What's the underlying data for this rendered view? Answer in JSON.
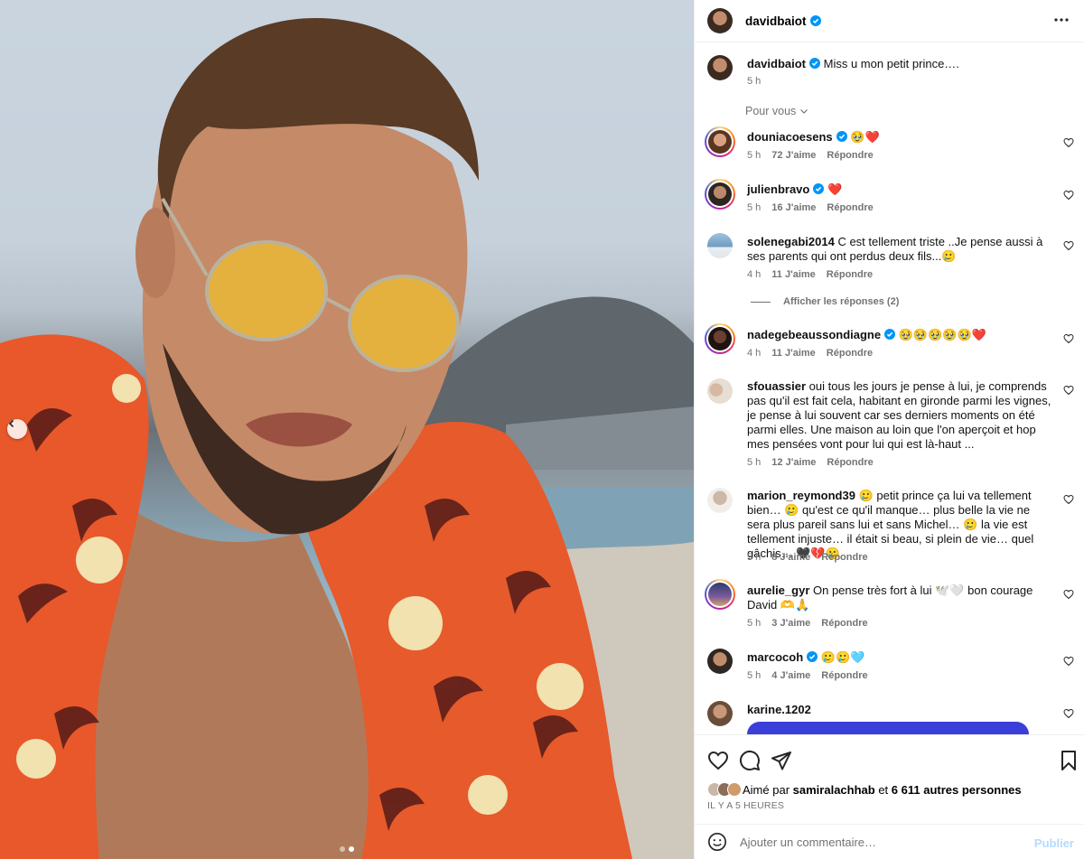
{
  "post": {
    "author": "davidbaiot",
    "caption_author": "davidbaiot",
    "caption": "Miss u mon petit prince….",
    "caption_time": "5 h"
  },
  "sort": {
    "label": "Pour vous"
  },
  "comments": [
    {
      "user": "douniacoesens",
      "verified": true,
      "text": "🥹❤️",
      "time": "5 h",
      "likes": "72 J'aime",
      "reply": "Répondre"
    },
    {
      "user": "julienbravo",
      "verified": true,
      "text": "❤️",
      "time": "5 h",
      "likes": "16 J'aime",
      "reply": "Répondre"
    },
    {
      "user": "solenegabi2014",
      "verified": false,
      "text": "C est tellement triste ..Je pense aussi à ses parents qui ont perdus deux fils...🥲",
      "time": "4 h",
      "likes": "11 J'aime",
      "reply": "Répondre"
    },
    {
      "user": "nadegebeaussondiagne",
      "verified": true,
      "text": "🥹🥹🥹🥹🥹❤️",
      "time": "4 h",
      "likes": "11 J'aime",
      "reply": "Répondre"
    },
    {
      "user": "sfouassier",
      "verified": false,
      "text": "oui tous les jours je pense à lui, je comprends pas qu'il est fait cela, habitant en gironde parmi les vignes, je pense à lui souvent car ses derniers moments on été parmi elles. Une maison au loin que l'on aperçoit et hop mes pensées vont pour lui qui est là-haut ...",
      "time": "5 h",
      "likes": "12 J'aime",
      "reply": "Répondre"
    },
    {
      "user": "marion_reymond39",
      "verified": false,
      "text": "🥲 petit prince ça lui va tellement bien… 🥲 qu'est ce qu'il manque… plus belle la vie ne sera plus pareil sans lui et sans Michel… 🥲 la vie est tellement injuste… il était si beau, si plein de vie… quel gâchis… 🖤💔🥲",
      "time": "5 h",
      "likes": "8 J'aime",
      "reply": "Répondre"
    },
    {
      "user": "aurelie_gyr",
      "verified": false,
      "text": "On pense très fort à lui 🕊️🤍 bon courage David 🫶🙏",
      "time": "5 h",
      "likes": "3 J'aime",
      "reply": "Répondre"
    },
    {
      "user": "marcocoh",
      "verified": true,
      "text": "🥲🥲🩵",
      "time": "5 h",
      "likes": "4 J'aime",
      "reply": "Répondre"
    },
    {
      "user": "karine.1202",
      "verified": false,
      "text": "",
      "time": "",
      "likes": "",
      "reply": ""
    }
  ],
  "view_replies": "Afficher les réponses (2)",
  "likes": {
    "prefix": "Aimé par",
    "user": "samiralachhab",
    "conj": "et",
    "others": "6 611 autres personnes",
    "ago": "IL Y A 5 HEURES"
  },
  "composer": {
    "placeholder": "Ajouter un commentaire…",
    "publish": "Publier"
  },
  "colors": {
    "accent": "#0095f6",
    "muted": "#737373",
    "shirt": "#e8582a",
    "publish_disabled": "#b3dbff"
  }
}
